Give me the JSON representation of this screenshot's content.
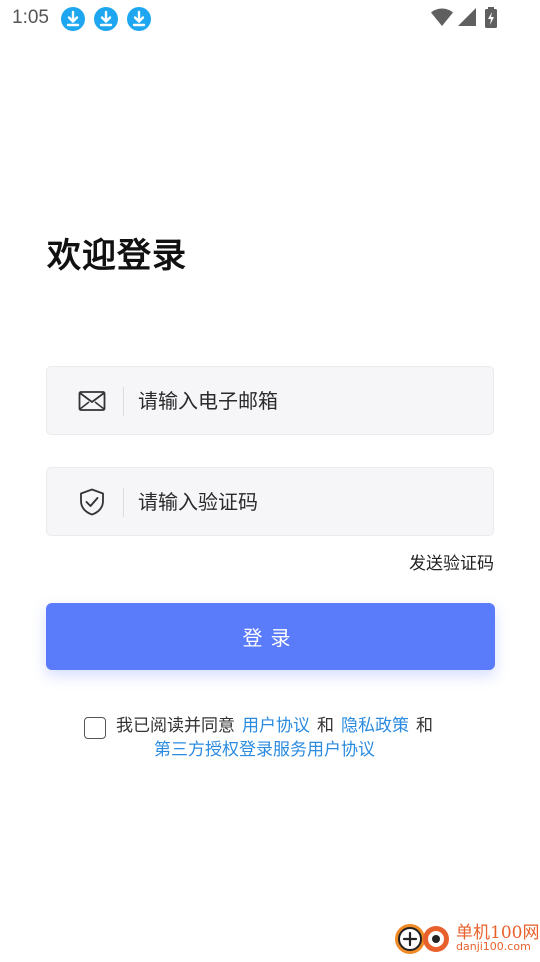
{
  "status_bar": {
    "time": "1:05",
    "download_icons": [
      "download-icon",
      "download-icon",
      "download-icon"
    ],
    "right_icons": [
      "wifi-icon",
      "signal-icon",
      "battery-charging-icon"
    ]
  },
  "title": "欢迎登录",
  "email_field": {
    "icon": "mail-icon",
    "placeholder": "请输入电子邮箱",
    "value": ""
  },
  "code_field": {
    "icon": "shield-check-icon",
    "placeholder": "请输入验证码",
    "value": ""
  },
  "send_code_label": "发送验证码",
  "login_button_label": "登录",
  "agreement": {
    "checked": false,
    "prefix": "我已阅读并同意",
    "user_agreement": "用户协议",
    "and1": "和",
    "privacy_policy": "隐私政策",
    "and2": "和",
    "third_party": "第三方授权登录服务用户协议"
  },
  "watermark": {
    "line1": "单机100网",
    "line2": "danji100.com"
  },
  "colors": {
    "accent": "#5a7bfa",
    "link": "#2b8be0",
    "download_badge": "#1ea7f0",
    "watermark": "#e8612c"
  }
}
